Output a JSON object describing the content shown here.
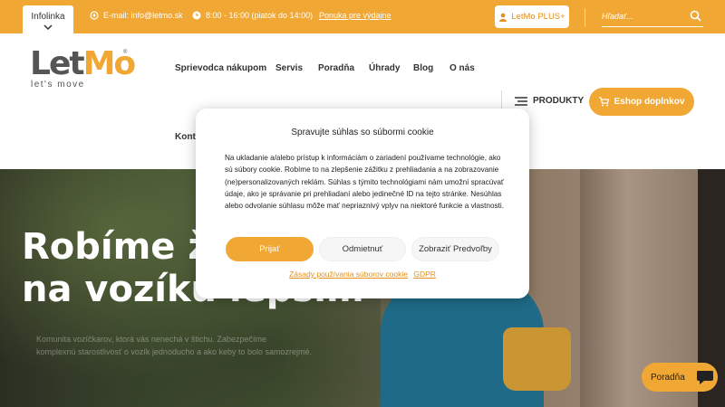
{
  "topbar": {
    "infolinka": "Infolinka",
    "email": "E-mail: info@letmo.sk",
    "hours": "8:00 - 16:00 (piatok do 14:00)",
    "offer_link": "Ponuka pre výdajne",
    "plus_button": "LetMo PLUS+",
    "search_placeholder": "Hľadať..."
  },
  "logo": {
    "let": "Let",
    "mo": "Mo",
    "reg": "®",
    "tagline": "let's move"
  },
  "nav": {
    "items": [
      "Sprievodca nákupom",
      "Servis",
      "Poradňa",
      "Úhrady",
      "Blog",
      "O nás",
      "Kontakt"
    ],
    "products": "PRODUKTY",
    "eshop": "Eshop doplnkov"
  },
  "hero": {
    "title_line1": "Robíme život",
    "title_line2": "na vozíku lepším",
    "subtitle_line1": "Komunita vozíčkarov, ktorá vás nenechá v štichu. Zabezpečíme",
    "subtitle_line2": "komplexnú starostlivosť o vozík jednoducho a ako keby to bolo samozrejmé."
  },
  "cookie_modal": {
    "title": "Spravujte súhlas so súbormi cookie",
    "body": "Na ukladanie a/alebo prístup k informáciám o zariadení používame technológie, ako sú súbory cookie. Robíme to na zlepšenie zážitku z prehliadania a na zobrazovanie (ne)personalizovaných reklám. Súhlas s týmito technológiami nám umožní spracúvať údaje, ako je správanie pri prehliadaní alebo jedinečné ID na tejto stránke. Nesúhlas alebo odvolanie súhlasu môže mať nepriaznivý vplyv na niektoré funkcie a vlastnosti.",
    "accept": "Prijať",
    "deny": "Odmietnuť",
    "preferences": "Zobraziť Predvoľby",
    "policy_link": "Zásady používania súborov cookie",
    "gdpr_link": "GDPR"
  },
  "chat": {
    "label": "Poradňa"
  },
  "colors": {
    "accent": "#f0a733",
    "accent_dark": "#e38f1c"
  }
}
